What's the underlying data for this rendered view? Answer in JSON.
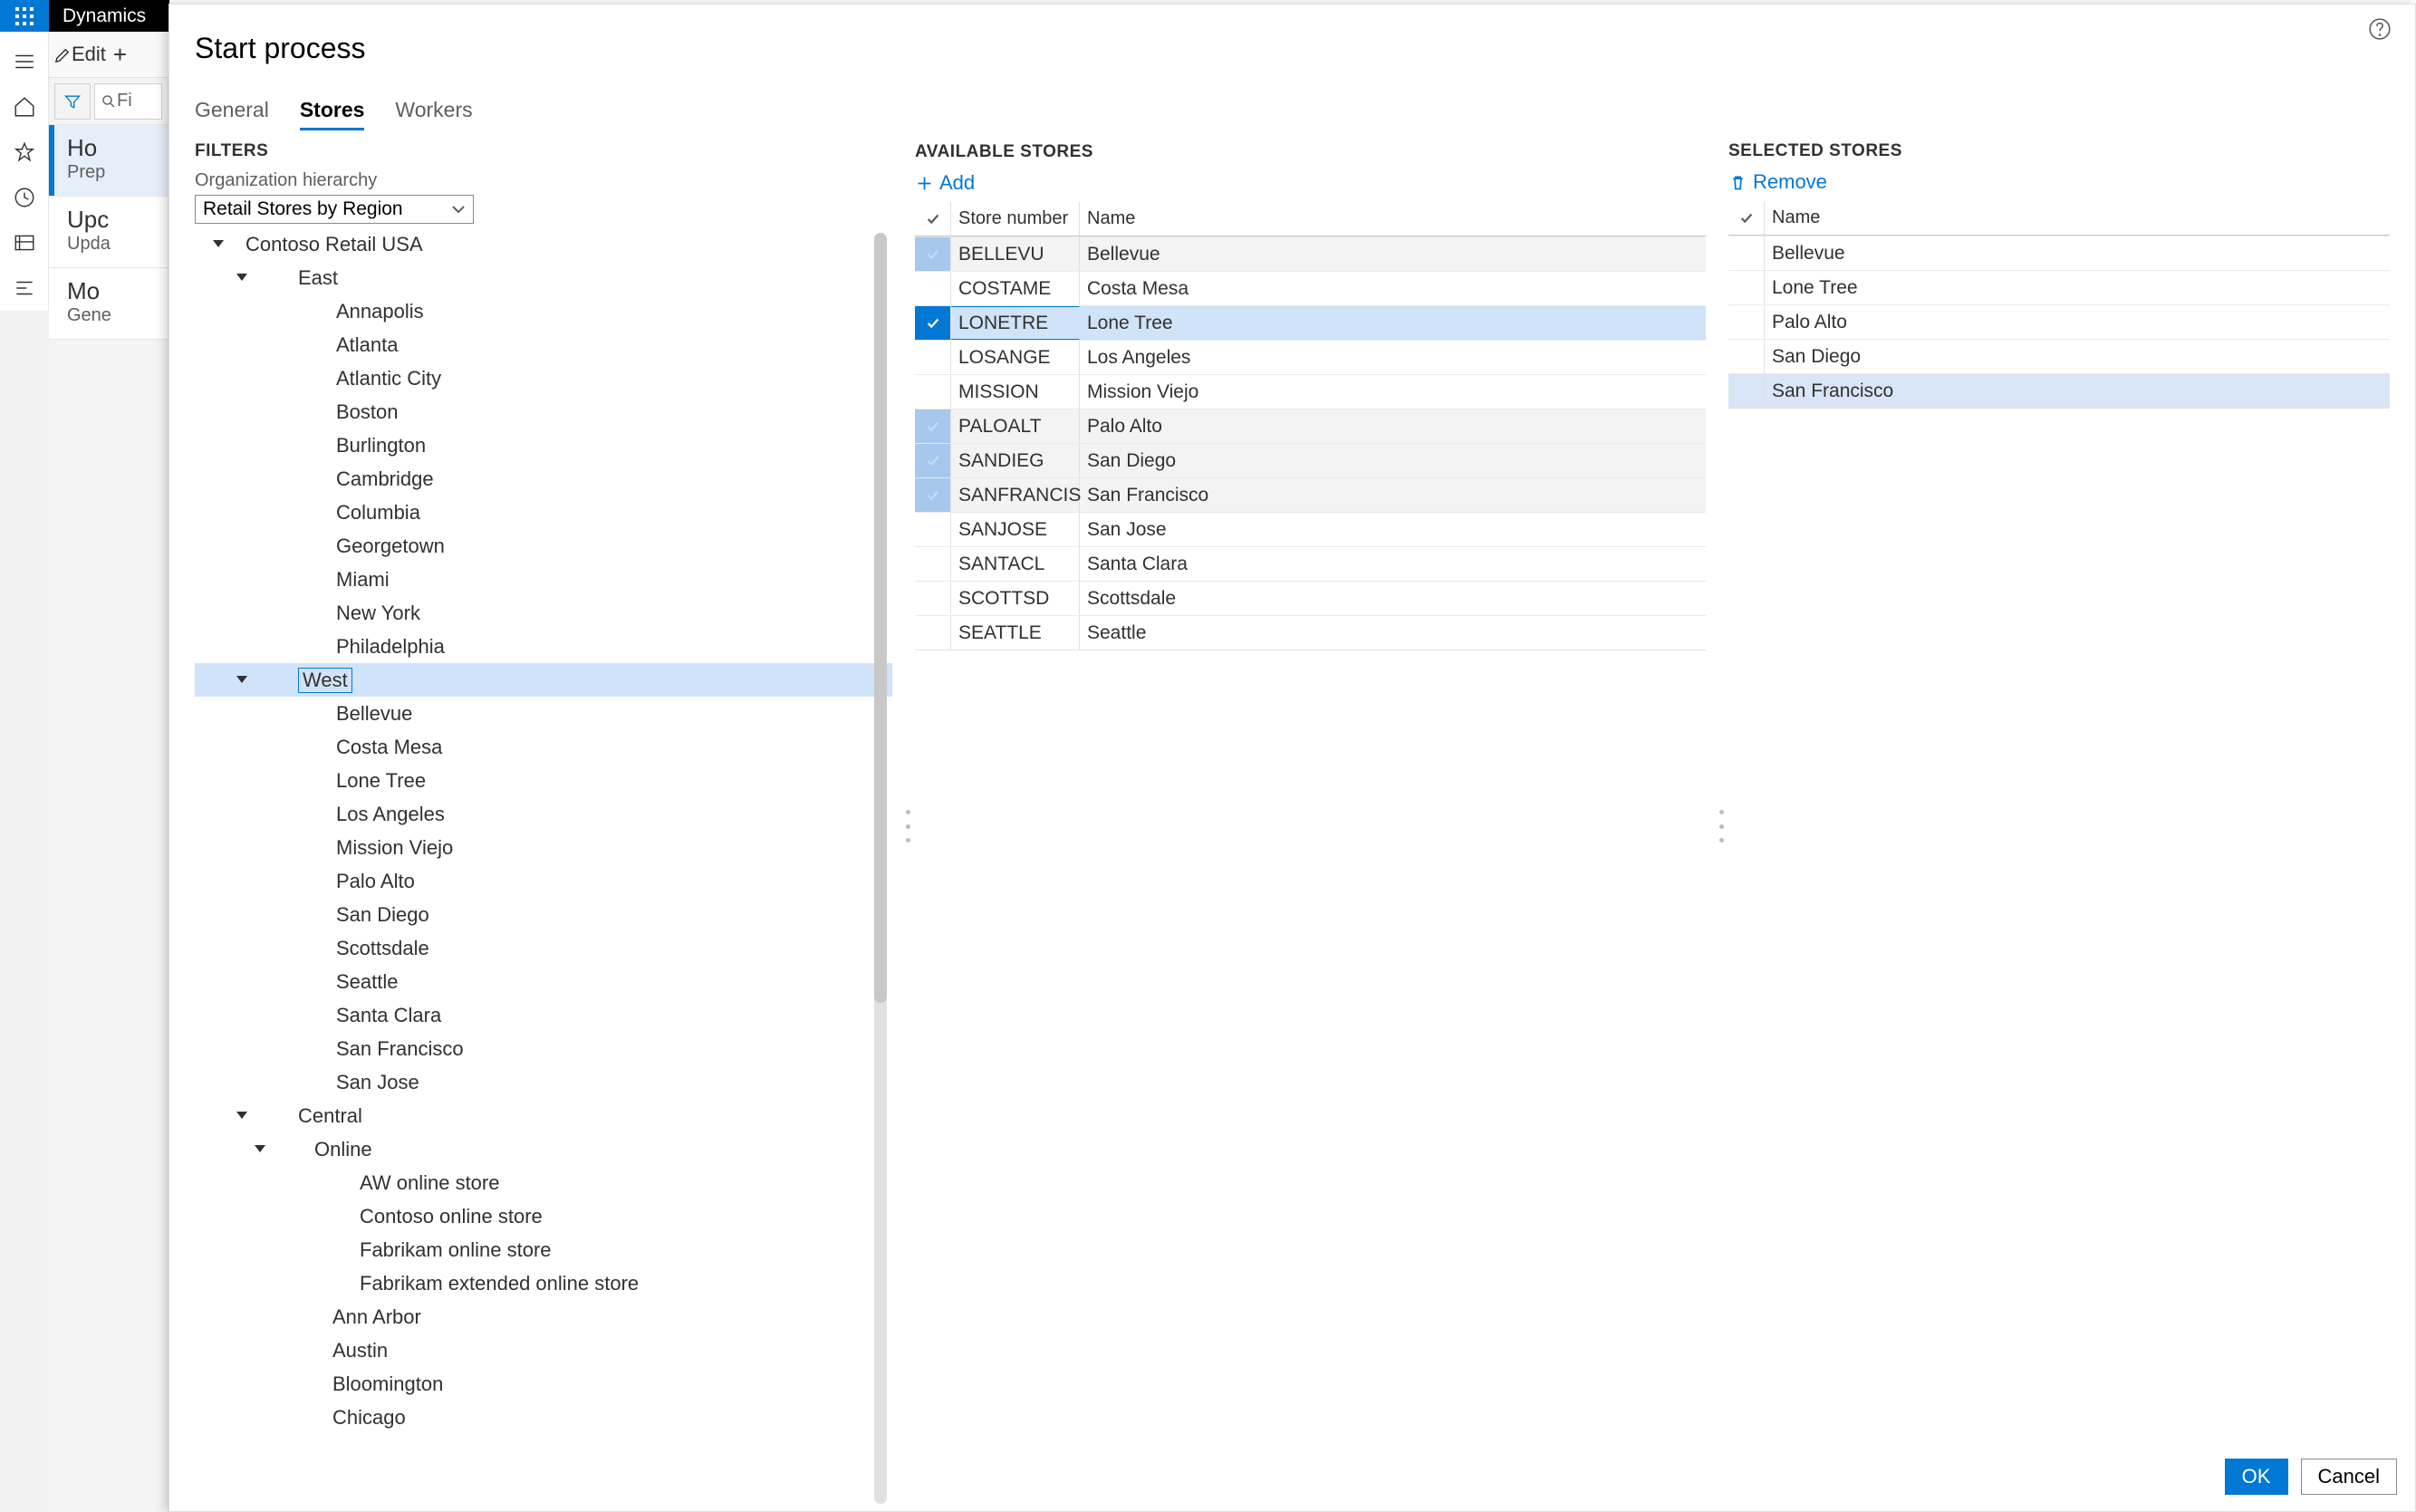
{
  "titlebar": {
    "app_name": "Dynamics"
  },
  "back": {
    "edit_label": "Edit",
    "filter_placeholder": "Fi",
    "cards": [
      {
        "title": "Ho",
        "sub": "Prep",
        "active": true
      },
      {
        "title": "Upc",
        "sub": "Upda",
        "active": false
      },
      {
        "title": "Mo",
        "sub": "Gene",
        "active": false
      }
    ]
  },
  "dialog": {
    "title": "Start process",
    "tabs": [
      {
        "id": "general",
        "label": "General",
        "selected": false
      },
      {
        "id": "stores",
        "label": "Stores",
        "selected": true
      },
      {
        "id": "workers",
        "label": "Workers",
        "selected": false
      }
    ],
    "filters_hdr": "FILTERS",
    "org_hierarchy_label": "Organization hierarchy",
    "org_hierarchy_value": "Retail Stores by Region",
    "tree": [
      {
        "indent": 0,
        "expand": true,
        "label": "Contoso Retail USA"
      },
      {
        "indent": 1,
        "expand": true,
        "label": "East"
      },
      {
        "indent": 2,
        "expand": false,
        "label": "Annapolis"
      },
      {
        "indent": 2,
        "expand": false,
        "label": "Atlanta"
      },
      {
        "indent": 2,
        "expand": false,
        "label": "Atlantic City"
      },
      {
        "indent": 2,
        "expand": false,
        "label": "Boston"
      },
      {
        "indent": 2,
        "expand": false,
        "label": "Burlington"
      },
      {
        "indent": 2,
        "expand": false,
        "label": "Cambridge"
      },
      {
        "indent": 2,
        "expand": false,
        "label": "Columbia"
      },
      {
        "indent": 2,
        "expand": false,
        "label": "Georgetown"
      },
      {
        "indent": 2,
        "expand": false,
        "label": "Miami"
      },
      {
        "indent": 2,
        "expand": false,
        "label": "New York"
      },
      {
        "indent": 2,
        "expand": false,
        "label": "Philadelphia"
      },
      {
        "indent": 1,
        "expand": true,
        "label": "West",
        "selected": true
      },
      {
        "indent": 2,
        "expand": false,
        "label": "Bellevue"
      },
      {
        "indent": 2,
        "expand": false,
        "label": "Costa Mesa"
      },
      {
        "indent": 2,
        "expand": false,
        "label": "Lone Tree"
      },
      {
        "indent": 2,
        "expand": false,
        "label": "Los Angeles"
      },
      {
        "indent": 2,
        "expand": false,
        "label": "Mission Viejo"
      },
      {
        "indent": 2,
        "expand": false,
        "label": "Palo Alto"
      },
      {
        "indent": 2,
        "expand": false,
        "label": "San Diego"
      },
      {
        "indent": 2,
        "expand": false,
        "label": "Scottsdale"
      },
      {
        "indent": 2,
        "expand": false,
        "label": "Seattle"
      },
      {
        "indent": 2,
        "expand": false,
        "label": "Santa Clara"
      },
      {
        "indent": 2,
        "expand": false,
        "label": "San Francisco"
      },
      {
        "indent": 2,
        "expand": false,
        "label": "San Jose"
      },
      {
        "indent": 1,
        "expand": true,
        "label": "Central"
      },
      {
        "indent": 3,
        "expand": true,
        "label": "Online"
      },
      {
        "indent": 4,
        "expand": false,
        "label": "AW online store"
      },
      {
        "indent": 4,
        "expand": false,
        "label": "Contoso online store"
      },
      {
        "indent": 4,
        "expand": false,
        "label": "Fabrikam online store"
      },
      {
        "indent": 4,
        "expand": false,
        "label": "Fabrikam extended online store"
      },
      {
        "indent": 5,
        "expand": false,
        "label": "Ann Arbor"
      },
      {
        "indent": 5,
        "expand": false,
        "label": "Austin"
      },
      {
        "indent": 5,
        "expand": false,
        "label": "Bloomington"
      },
      {
        "indent": 5,
        "expand": false,
        "label": "Chicago"
      }
    ],
    "available_hdr": "AVAILABLE STORES",
    "add_label": "Add",
    "avail_cols": {
      "num": "Store number",
      "name": "Name"
    },
    "avail_rows": [
      {
        "num": "BELLEVU",
        "name": "Bellevue",
        "checked": true
      },
      {
        "num": "COSTAME",
        "name": "Costa Mesa",
        "checked": false
      },
      {
        "num": "LONETRE",
        "name": "Lone Tree",
        "checked": true,
        "focused": true
      },
      {
        "num": "LOSANGE",
        "name": "Los Angeles",
        "checked": false
      },
      {
        "num": "MISSION",
        "name": "Mission Viejo",
        "checked": false
      },
      {
        "num": "PALOALT",
        "name": "Palo Alto",
        "checked": true
      },
      {
        "num": "SANDIEG",
        "name": "San Diego",
        "checked": true
      },
      {
        "num": "SANFRANCIS",
        "name": "San Francisco",
        "checked": true
      },
      {
        "num": "SANJOSE",
        "name": "San Jose",
        "checked": false
      },
      {
        "num": "SANTACL",
        "name": "Santa Clara",
        "checked": false
      },
      {
        "num": "SCOTTSD",
        "name": "Scottsdale",
        "checked": false
      },
      {
        "num": "SEATTLE",
        "name": "Seattle",
        "checked": false
      }
    ],
    "selected_hdr": "SELECTED STORES",
    "remove_label": "Remove",
    "sel_col": "Name",
    "sel_rows": [
      {
        "name": "Bellevue"
      },
      {
        "name": "Lone Tree"
      },
      {
        "name": "Palo Alto"
      },
      {
        "name": "San Diego"
      },
      {
        "name": "San Francisco",
        "last": true
      }
    ],
    "ok_label": "OK",
    "cancel_label": "Cancel"
  }
}
